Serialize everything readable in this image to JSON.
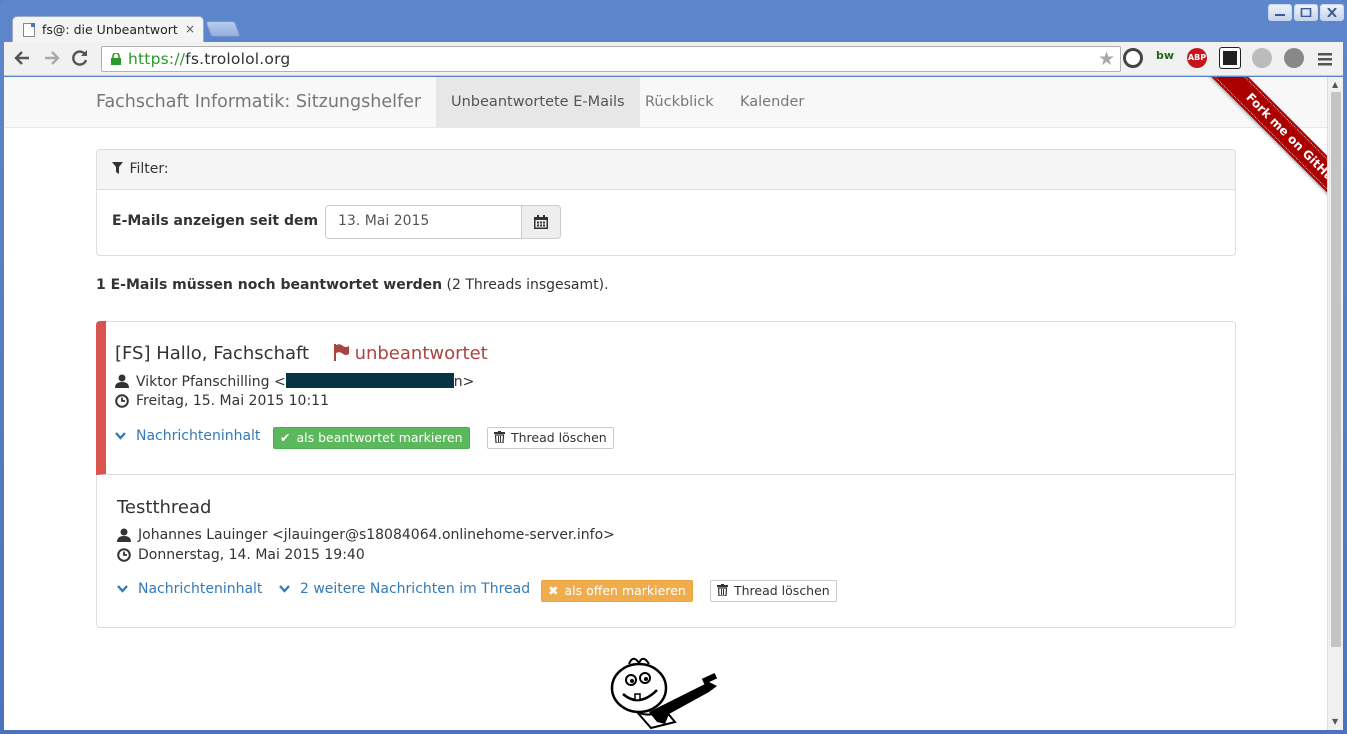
{
  "browser": {
    "tab_title": "fs@: die Unbeantwort",
    "tab_close": "×",
    "url_scheme": "https://",
    "url_host": "fs.trololol.org",
    "ext_bw": "bw",
    "ext_abp": "ABP"
  },
  "navbar": {
    "brand": "Fachschaft Informatik: Sitzungshelfer",
    "items": [
      {
        "label": "Unbeantwortete E-Mails"
      },
      {
        "label": "Rückblick"
      },
      {
        "label": "Kalender"
      }
    ],
    "ribbon": "Fork me on GitHub"
  },
  "filter": {
    "heading": "Filter:",
    "label": "E-Mails anzeigen seit dem",
    "date_value": "13. Mai 2015"
  },
  "summary": {
    "bold": "1 E-Mails müssen noch beantwortet werden",
    "rest": " (2 Threads insgesamt)."
  },
  "threads": [
    {
      "subject": "[FS] Hallo, Fachschaft",
      "status": "unbeantwortet",
      "sender_prefix": "Viktor Pfanschilling <",
      "sender_suffix": "n>",
      "date": "Freitag, 15. Mai 2015 10:11",
      "content_link": "Nachrichteninhalt",
      "mark_button": "als beantwortet markieren",
      "delete_button": "Thread löschen"
    },
    {
      "subject": "Testthread",
      "sender": "Johannes Lauinger <jlauinger@s18084064.onlinehome-server.info>",
      "date": "Donnerstag, 14. Mai 2015 19:40",
      "content_link": "Nachrichteninhalt",
      "more_link": "2 weitere Nachrichten im Thread",
      "mark_button": "als offen markieren",
      "delete_button": "Thread löschen"
    }
  ]
}
